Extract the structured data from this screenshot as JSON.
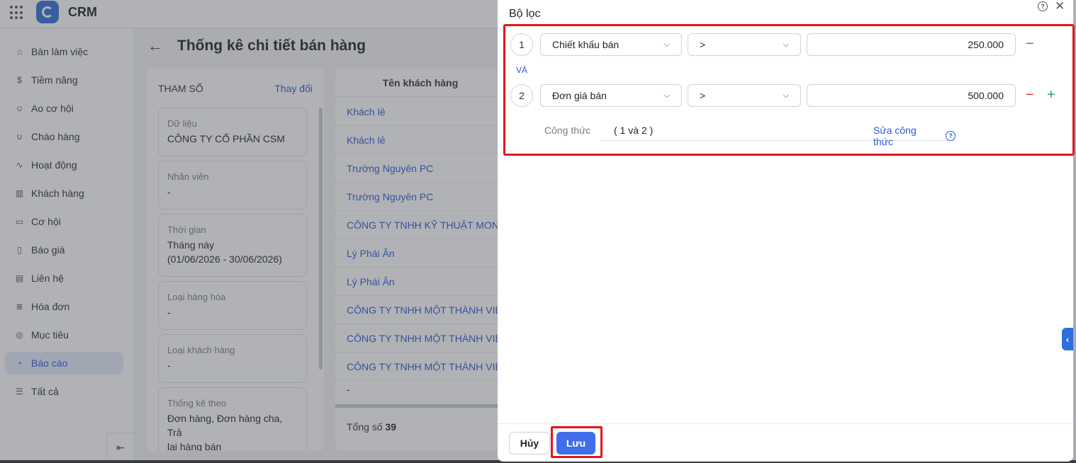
{
  "app": {
    "name": "CRM"
  },
  "sidebar": {
    "items": [
      {
        "label": "Bàn làm việc",
        "icon": "home-icon"
      },
      {
        "label": "Tiềm năng",
        "icon": "dollar-icon"
      },
      {
        "label": "Ao cơ hội",
        "icon": "user-icon"
      },
      {
        "label": "Chào hàng",
        "icon": "magnet-icon"
      },
      {
        "label": "Hoạt động",
        "icon": "activity-icon"
      },
      {
        "label": "Khách hàng",
        "icon": "building-icon"
      },
      {
        "label": "Cơ hội",
        "icon": "briefcase-icon"
      },
      {
        "label": "Báo giá",
        "icon": "quote-icon"
      },
      {
        "label": "Liên hệ",
        "icon": "contact-icon"
      },
      {
        "label": "Hóa đơn",
        "icon": "invoice-icon"
      },
      {
        "label": "Mục tiêu",
        "icon": "target-icon"
      },
      {
        "label": "Báo cáo",
        "icon": "chart-icon",
        "active": true
      },
      {
        "label": "Tất cả",
        "icon": "menu-icon"
      }
    ]
  },
  "page": {
    "title": "Thống kê chi tiết bán hàng"
  },
  "params": {
    "header": "THAM SỐ",
    "change_link": "Thay đổi",
    "cards": [
      {
        "label": "Dữ liệu",
        "value": "CÔNG TY CỔ PHẦN CSM"
      },
      {
        "label": "Nhân viên",
        "value": "-"
      },
      {
        "label": "Thời gian",
        "value": "Tháng này",
        "value2": "(01/06/2026 - 30/06/2026)"
      },
      {
        "label": "Loại hàng hóa",
        "value": "-"
      },
      {
        "label": "Loại khách hàng",
        "value": "-"
      },
      {
        "label": "Thống kê theo",
        "value": "Đơn hàng, Đơn hàng cha, Trả",
        "value2": "lại hàng bán"
      }
    ]
  },
  "table": {
    "column": "Tên khách hàng",
    "rows": [
      "Khách lẻ",
      "Khách lẻ",
      "Trường Nguyên PC",
      "Trường Nguyên PC",
      "CÔNG TY TNHH KỸ THUẬT MON",
      "Lý Phái Ân",
      "Lý Phái Ân",
      "CÔNG TY TNHH MỘT THÀNH VIÊN",
      "CÔNG TY TNHH MỘT THÀNH VIÊN",
      "CÔNG TY TNHH MỘT THÀNH VIÊN",
      "-"
    ],
    "total_label": "Tổng số",
    "total_value": "39"
  },
  "filter_dialog": {
    "title": "Bộ lọc",
    "conditions": [
      {
        "index": "1",
        "field": "Chiết khấu bán",
        "operator": ">",
        "value": "250.000"
      },
      {
        "index": "2",
        "field": "Đơn giá bán",
        "operator": ">",
        "value": "500.000"
      }
    ],
    "conjunction": "VÀ",
    "formula_label": "Công thức",
    "formula_value": "( 1 và 2 )",
    "formula_edit": "Sửa công thức",
    "cancel_label": "Hủy",
    "save_label": "Lưu"
  },
  "colors": {
    "accent": "#2a5ad6",
    "primary_button": "#3f6ee8",
    "highlight": "#e3161b",
    "remove": "#e03b3b",
    "add": "#27a36b"
  }
}
